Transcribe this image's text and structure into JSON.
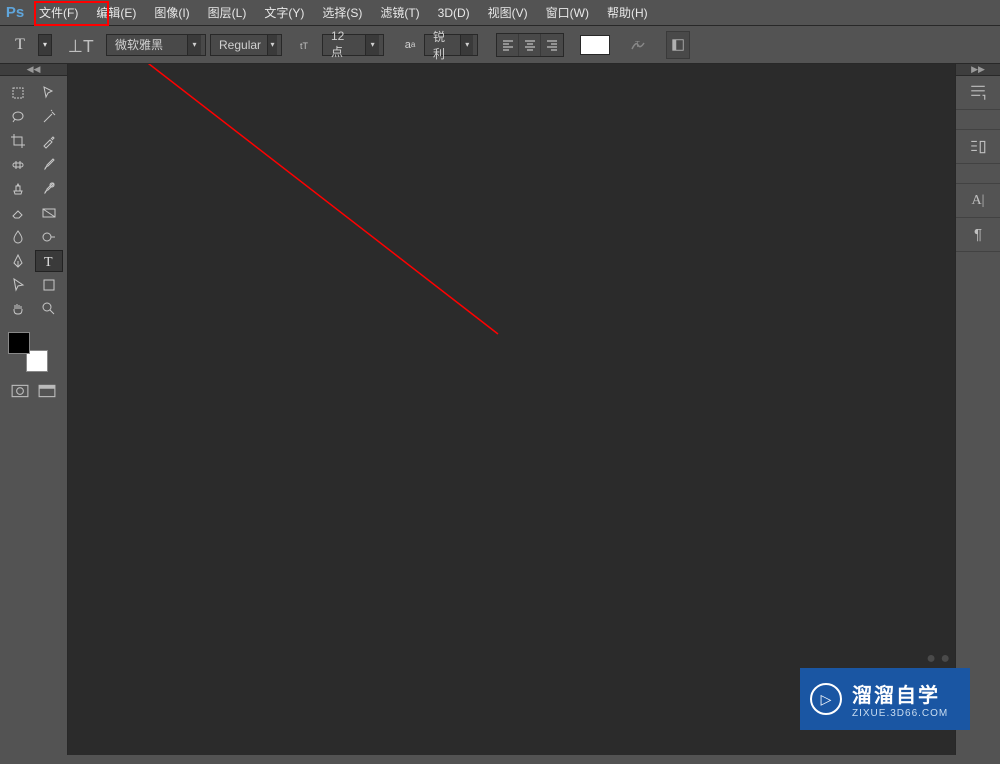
{
  "app": {
    "logo": "Ps"
  },
  "menu": {
    "file": "文件(F)",
    "edit": "编辑(E)",
    "image": "图像(I)",
    "layer": "图层(L)",
    "type": "文字(Y)",
    "select": "选择(S)",
    "filter": "滤镜(T)",
    "threed": "3D(D)",
    "view": "视图(V)",
    "window": "窗口(W)",
    "help": "帮助(H)"
  },
  "options": {
    "font_family": "微软雅黑",
    "font_style": "Regular",
    "font_size": "12 点",
    "anti_alias": "锐利"
  },
  "watermark": {
    "title": "溜溜自学",
    "url": "ZIXUE.3D66.COM"
  }
}
